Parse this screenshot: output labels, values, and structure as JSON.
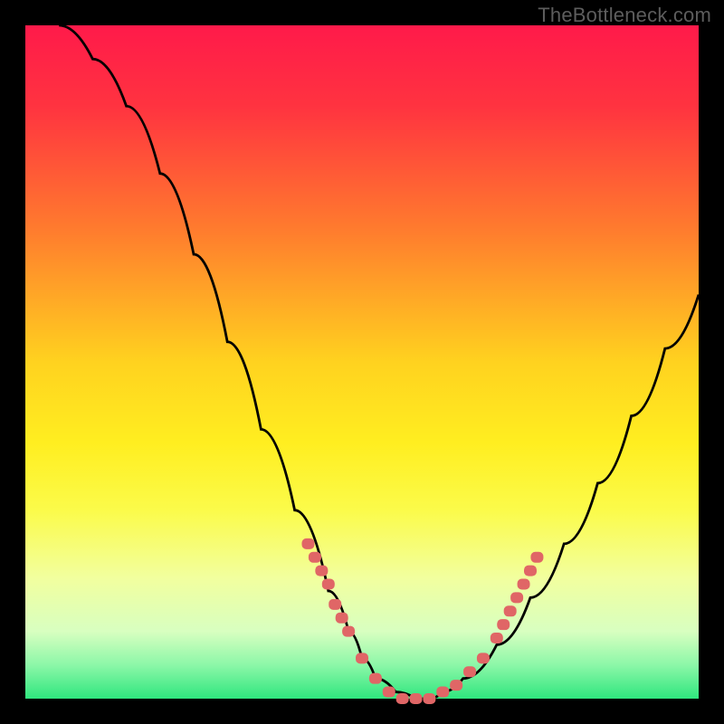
{
  "watermark": "TheBottleneck.com",
  "chart_data": {
    "type": "line",
    "title": "",
    "xlabel": "",
    "ylabel": "",
    "xlim": [
      0,
      100
    ],
    "ylim": [
      0,
      100
    ],
    "background_gradient": {
      "stops": [
        {
          "offset": 0.0,
          "color": "#ff1a4a"
        },
        {
          "offset": 0.12,
          "color": "#ff3340"
        },
        {
          "offset": 0.3,
          "color": "#ff7a2e"
        },
        {
          "offset": 0.5,
          "color": "#ffd21f"
        },
        {
          "offset": 0.62,
          "color": "#ffee20"
        },
        {
          "offset": 0.72,
          "color": "#fbfb4a"
        },
        {
          "offset": 0.82,
          "color": "#f2ff9e"
        },
        {
          "offset": 0.9,
          "color": "#d8ffc0"
        },
        {
          "offset": 0.95,
          "color": "#8cf7a8"
        },
        {
          "offset": 1.0,
          "color": "#2fe67e"
        }
      ]
    },
    "series": [
      {
        "name": "bottleneck-curve",
        "color": "#000000",
        "x": [
          5,
          10,
          15,
          20,
          25,
          30,
          35,
          40,
          45,
          48,
          50,
          52,
          55,
          58,
          60,
          62,
          65,
          70,
          75,
          80,
          85,
          90,
          95,
          100
        ],
        "y": [
          100,
          95,
          88,
          78,
          66,
          53,
          40,
          28,
          16,
          10,
          6,
          3,
          1,
          0,
          0,
          1,
          3,
          8,
          15,
          23,
          32,
          42,
          52,
          60
        ]
      }
    ],
    "markers": {
      "name": "highlighted-range",
      "color": "#e06666",
      "points": [
        {
          "x": 42,
          "y": 23
        },
        {
          "x": 43,
          "y": 21
        },
        {
          "x": 44,
          "y": 19
        },
        {
          "x": 45,
          "y": 17
        },
        {
          "x": 46,
          "y": 14
        },
        {
          "x": 47,
          "y": 12
        },
        {
          "x": 48,
          "y": 10
        },
        {
          "x": 50,
          "y": 6
        },
        {
          "x": 52,
          "y": 3
        },
        {
          "x": 54,
          "y": 1
        },
        {
          "x": 56,
          "y": 0
        },
        {
          "x": 58,
          "y": 0
        },
        {
          "x": 60,
          "y": 0
        },
        {
          "x": 62,
          "y": 1
        },
        {
          "x": 64,
          "y": 2
        },
        {
          "x": 66,
          "y": 4
        },
        {
          "x": 68,
          "y": 6
        },
        {
          "x": 70,
          "y": 9
        },
        {
          "x": 71,
          "y": 11
        },
        {
          "x": 72,
          "y": 13
        },
        {
          "x": 73,
          "y": 15
        },
        {
          "x": 74,
          "y": 17
        },
        {
          "x": 75,
          "y": 19
        },
        {
          "x": 76,
          "y": 21
        }
      ]
    }
  }
}
